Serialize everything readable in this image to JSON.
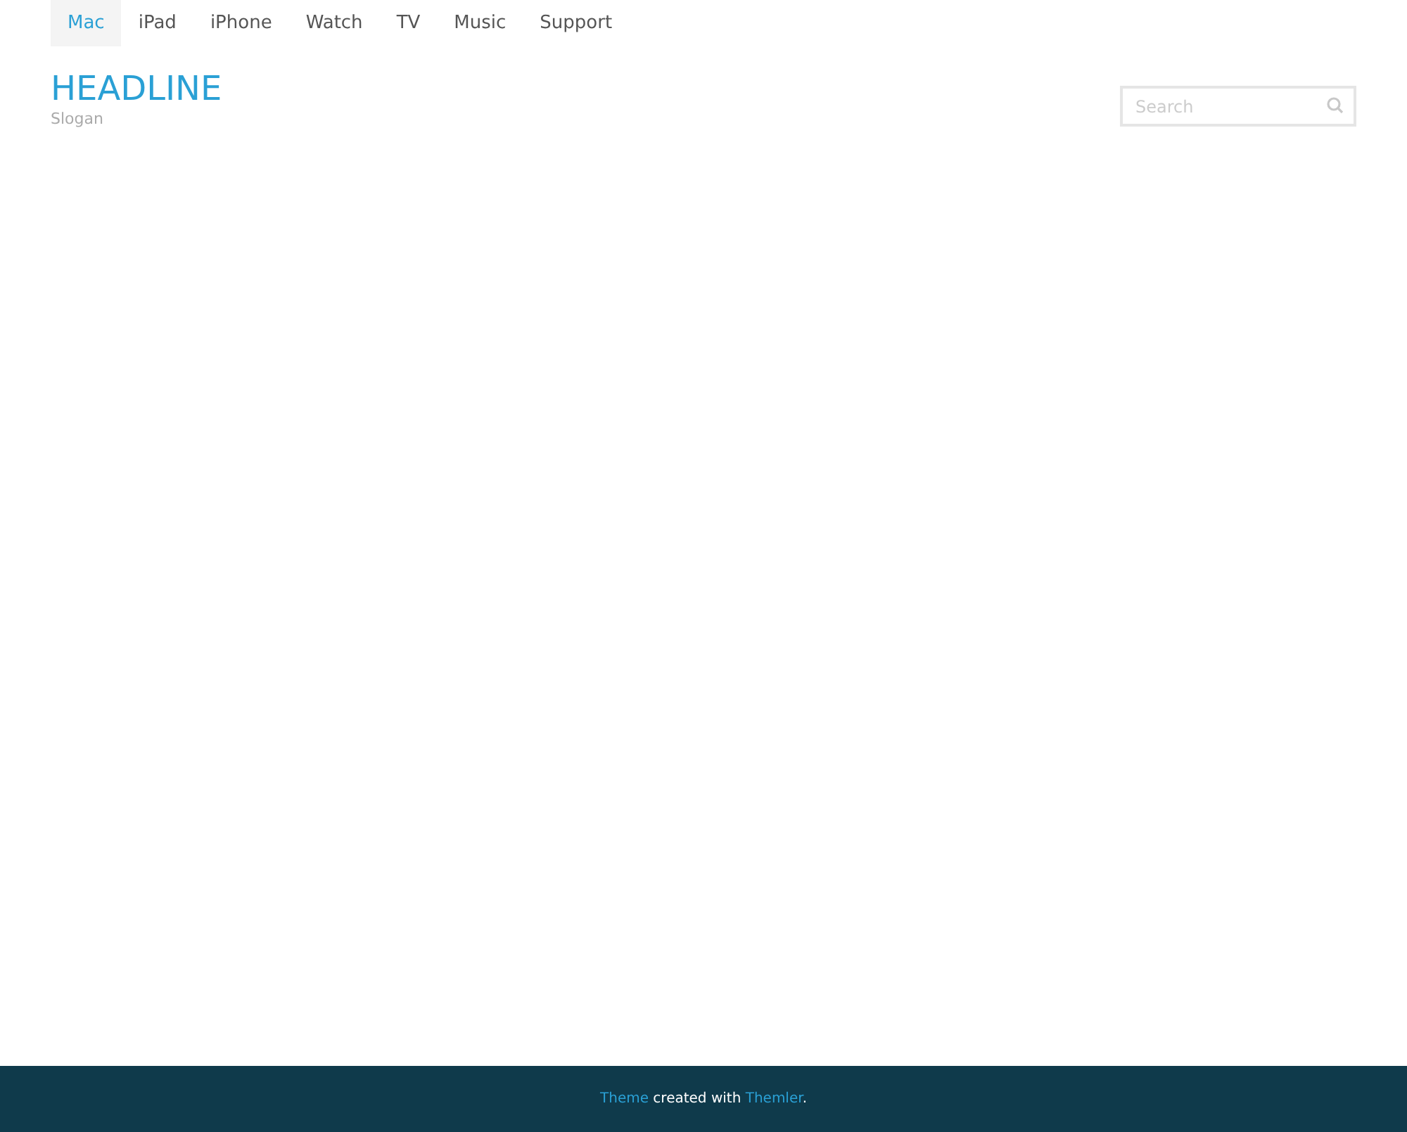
{
  "nav": [
    {
      "label": "Mac",
      "selected": true
    },
    {
      "label": "iPad",
      "selected": false
    },
    {
      "label": "iPhone",
      "selected": false
    },
    {
      "label": "Watch",
      "selected": false
    },
    {
      "label": "TV",
      "selected": false
    },
    {
      "label": "Music",
      "selected": false
    },
    {
      "label": "Support",
      "selected": false
    }
  ],
  "header": {
    "headline": "HEADLINE",
    "slogan": "Slogan"
  },
  "search": {
    "placeholder": "Search"
  },
  "footer": [
    {
      "kind": "link",
      "text": "Theme"
    },
    {
      "kind": "text",
      "text": " created with "
    },
    {
      "kind": "link",
      "text": "Themler"
    },
    {
      "kind": "text",
      "text": "."
    }
  ]
}
